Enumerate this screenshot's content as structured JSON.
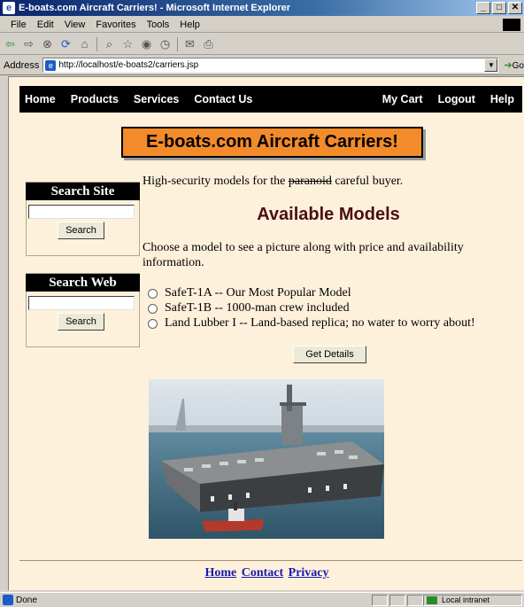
{
  "window": {
    "title": "E-boats.com Aircraft Carriers! - Microsoft Internet Explorer",
    "controls": [
      "_",
      "□",
      "✕"
    ]
  },
  "menu": [
    "File",
    "Edit",
    "View",
    "Favorites",
    "Tools",
    "Help"
  ],
  "address": {
    "label": "Address",
    "url": "http://localhost/e-boats2/carriers.jsp",
    "go": "Go"
  },
  "nav": {
    "left": [
      "Home",
      "Products",
      "Services",
      "Contact Us"
    ],
    "right": [
      "My Cart",
      "Logout",
      "Help"
    ]
  },
  "banner": "E-boats.com Aircraft Carriers!",
  "search_site": {
    "title": "Search Site",
    "value": "",
    "button": "Search"
  },
  "search_web": {
    "title": "Search Web",
    "value": "",
    "button": "Search"
  },
  "intro": {
    "before": "High-security models for the ",
    "struck": "paranoid",
    "after": " careful buyer."
  },
  "heading": "Available Models",
  "description": "Choose a model to see a picture along with price and availability information.",
  "models": [
    "SafeT-1A -- Our Most Popular Model",
    "SafeT-1B -- 1000-man crew included",
    "Land Lubber I -- Land-based replica; no water to worry about!"
  ],
  "details_button": "Get Details",
  "footer": [
    "Home",
    "Contact",
    "Privacy"
  ],
  "status": {
    "text": "Done",
    "zone": "Local intranet"
  },
  "colors": {
    "page_bg": "#fef1dc",
    "banner_bg": "#f38b2a",
    "heading": "#4a0f0f",
    "link": "#1a1ab0"
  }
}
